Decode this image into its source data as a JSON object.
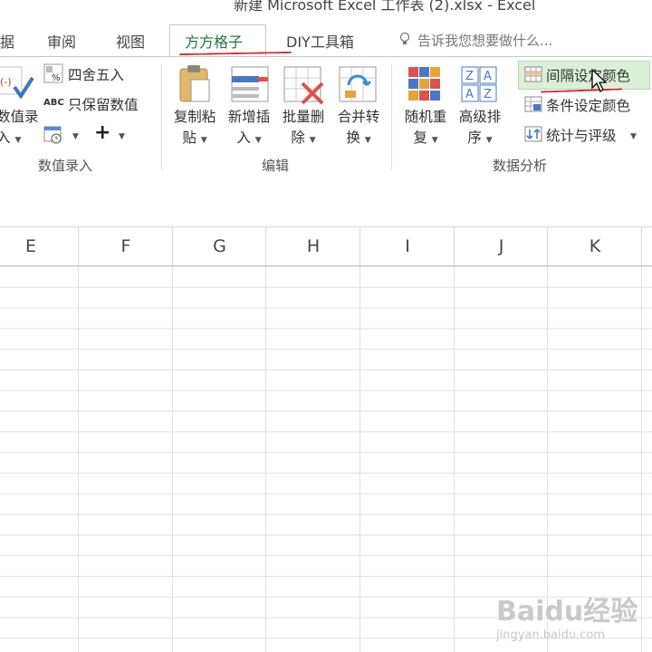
{
  "window": {
    "title": "新建 Microsoft Excel 工作表 (2).xlsx - Excel"
  },
  "tabs": [
    {
      "label": "据"
    },
    {
      "label": "审阅"
    },
    {
      "label": "视图"
    },
    {
      "label": "方方格子",
      "active": true
    },
    {
      "label": "DIY工具箱"
    }
  ],
  "tell_me": {
    "placeholder": "告诉我您想要做什么..."
  },
  "ribbon": {
    "group_numeric": {
      "label": "数值录入",
      "big_button": {
        "line1": "数值录",
        "line2": "入"
      },
      "round": "四舍五入",
      "keep_numeric": "只保留数值",
      "abc_label": "ABC",
      "plus_label": "+"
    },
    "group_edit": {
      "label": "编辑",
      "copy_paste": {
        "line1": "复制粘",
        "line2": "贴"
      },
      "insert": {
        "line1": "新增插",
        "line2": "入"
      },
      "batch_delete": {
        "line1": "批量删",
        "line2": "除"
      },
      "merge": {
        "line1": "合并转",
        "line2": "换"
      }
    },
    "group_analysis": {
      "label": "数据分析",
      "random": {
        "line1": "随机重",
        "line2": "复"
      },
      "sort": {
        "line1": "高级排",
        "line2": "序"
      },
      "interval_color": "间隔设定颜色",
      "condition_color": "条件设定颜色",
      "stats_rating": "统计与评级"
    },
    "colors": {
      "accent": "#217346",
      "highlight": "#dcefd9",
      "annotation": "#d9252a"
    }
  },
  "sheet": {
    "columns": [
      "E",
      "F",
      "G",
      "H",
      "I",
      "J",
      "K"
    ]
  },
  "watermark": {
    "main": "Baidu经验",
    "sub": "jingyan.baidu.com"
  }
}
